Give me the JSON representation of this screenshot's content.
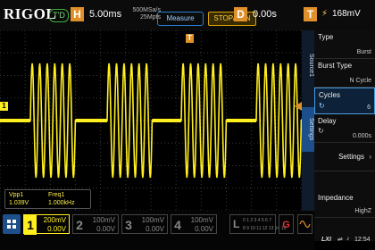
{
  "topbar": {
    "brand": "RIGOL",
    "run_state": "T'D",
    "horizontal_label": "H",
    "timebase": "5.00ms",
    "sample_rate": "500MSa/s",
    "memory_depth": "25Mpts",
    "measure_label": "Measure",
    "stoprun_label": "STOP/RUN",
    "delay_label": "D",
    "delay_value": "0.00s",
    "trigger_label": "T",
    "trigger_level": "168mV"
  },
  "side_tabs": [
    "Source1",
    "Settings"
  ],
  "menu": [
    {
      "label": "Type",
      "value": "Burst"
    },
    {
      "label": "Burst Type",
      "value": "N Cycle"
    },
    {
      "label": "Cycles",
      "value": "6"
    },
    {
      "label": "Delay",
      "value": "0.000s"
    },
    {
      "label": "Settings",
      "value": ""
    },
    {
      "label": "Impedance",
      "value": "HighZ"
    }
  ],
  "measurements": [
    {
      "name": "Vpp1",
      "value": "1.039V"
    },
    {
      "name": "Freq1",
      "value": "1.000kHz"
    }
  ],
  "channels": [
    {
      "num": "1",
      "scale": "200mV",
      "offset": "0.00V",
      "color": "#ffef1f"
    },
    {
      "num": "2",
      "scale": "100mV",
      "offset": "0.00V",
      "color": "#888888"
    },
    {
      "num": "3",
      "scale": "100mV",
      "offset": "0.00V",
      "color": "#888888"
    },
    {
      "num": "4",
      "scale": "100mV",
      "offset": "0.00V",
      "color": "#888888"
    }
  ],
  "logic_label": "L",
  "logic_top": "0 1 2 3 4 5 6 7",
  "logic_bot": "8 9 10 11 12 13 14 15",
  "generator_label": "G",
  "status": {
    "time": "12:54"
  },
  "waveform": {
    "color": "#ffef1f",
    "cycles_per_burst": 6,
    "burst_period_ms": 10
  },
  "markers": {
    "ch1_marker": "1",
    "trigger_marker": "T"
  }
}
